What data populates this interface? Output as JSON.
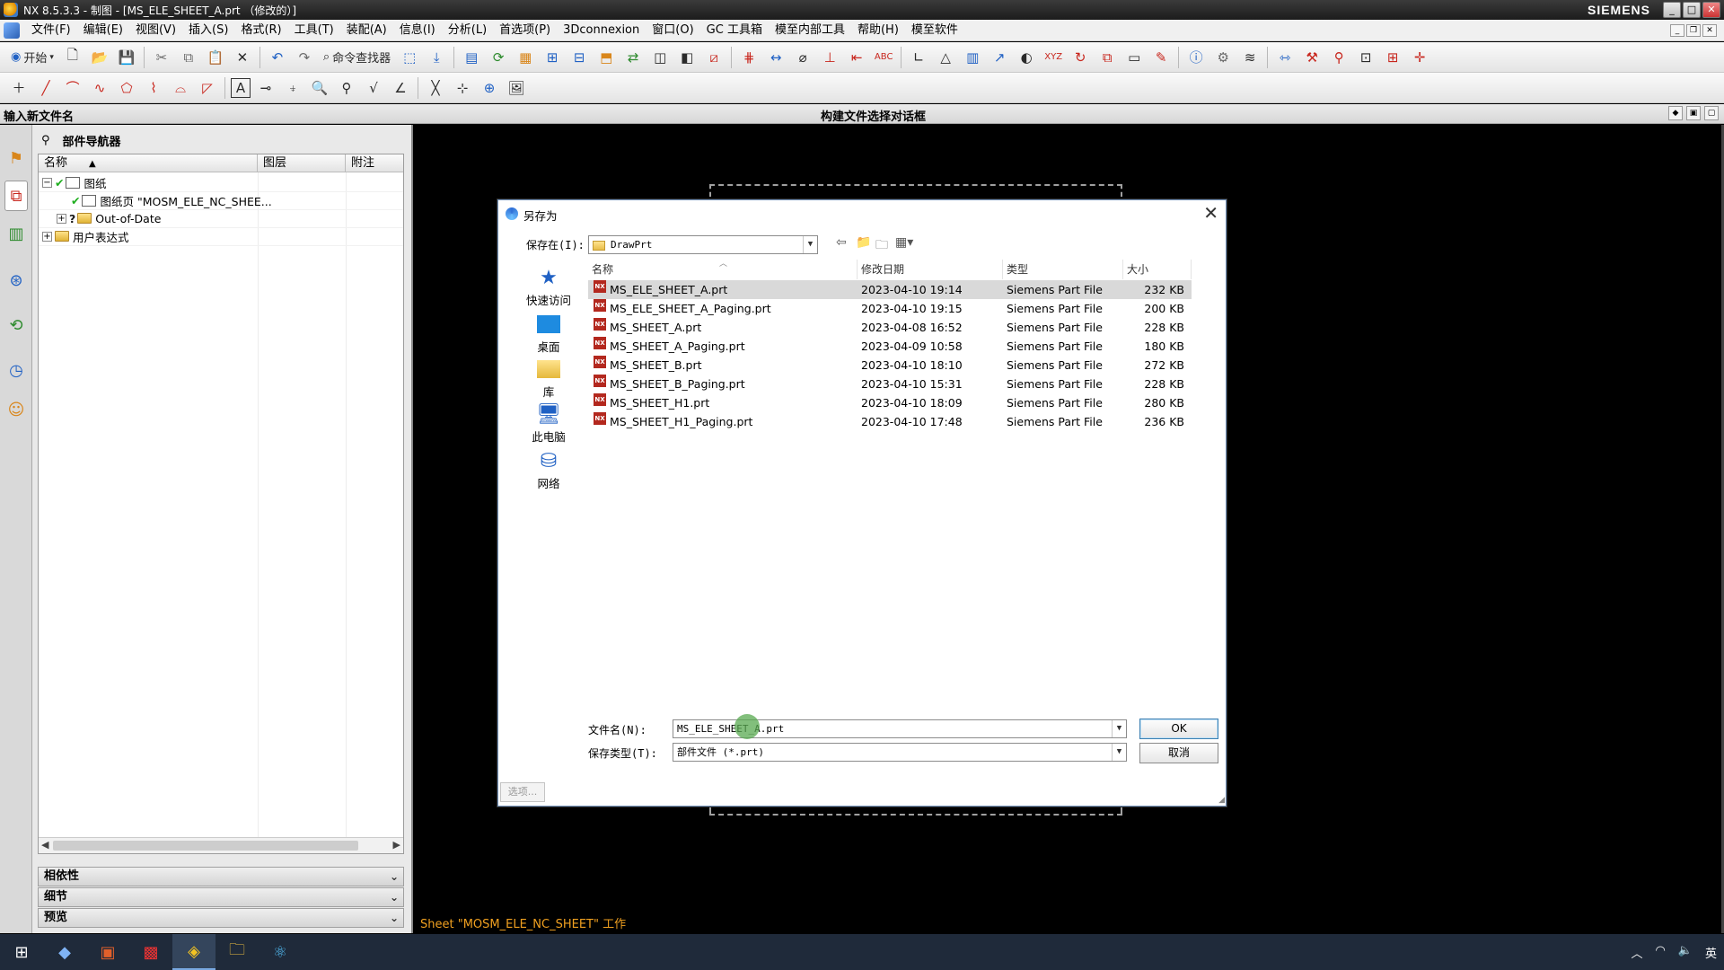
{
  "window": {
    "title": "NX 8.5.3.3 - 制图 - [MS_ELE_SHEET_A.prt （修改的）]",
    "brand": "SIEMENS",
    "controls": [
      "_",
      "□",
      "✕"
    ]
  },
  "menu": {
    "items": [
      "文件(F)",
      "编辑(E)",
      "视图(V)",
      "插入(S)",
      "格式(R)",
      "工具(T)",
      "装配(A)",
      "信息(I)",
      "分析(L)",
      "首选项(P)",
      "3Dconnexion",
      "窗口(O)",
      "GC 工具箱",
      "模至内部工具",
      "帮助(H)",
      "模至软件"
    ]
  },
  "toolbar1": {
    "start_label": "开始",
    "command_finder_label": "命令查找器"
  },
  "cue": {
    "left": "输入新文件名",
    "center": "构建文件选择对话框"
  },
  "navigator": {
    "title": "部件导航器",
    "columns": [
      "名称",
      "图层",
      "附注"
    ],
    "tree": [
      {
        "label": "图纸",
        "level": 0,
        "toggle": "−",
        "check": true
      },
      {
        "label": "图纸页 \"MOSM_ELE_NC_SHEE...",
        "level": 1,
        "toggle": "",
        "check": true
      },
      {
        "label": "Out-of-Date",
        "level": 1,
        "toggle": "+",
        "check": false,
        "question": "?"
      },
      {
        "label": "用户表达式",
        "level": 0,
        "toggle": "+",
        "check": false
      }
    ],
    "panels": [
      "相依性",
      "细节",
      "预览"
    ]
  },
  "graphics": {
    "status_message": "Sheet \"MOSM_ELE_NC_SHEET\" 工作"
  },
  "dialog": {
    "title": "另存为",
    "save_in_label": "保存在(I):",
    "save_in_value": "DrawPrt",
    "places": [
      "快速访问",
      "桌面",
      "库",
      "此电脑",
      "网络"
    ],
    "columns": [
      "名称",
      "修改日期",
      "类型",
      "大小"
    ],
    "files": [
      {
        "name": "MS_ELE_SHEET_A.prt",
        "date": "2023-04-10 19:14",
        "type": "Siemens Part File",
        "size": "232 KB",
        "selected": true
      },
      {
        "name": "MS_ELE_SHEET_A_Paging.prt",
        "date": "2023-04-10 19:15",
        "type": "Siemens Part File",
        "size": "200 KB"
      },
      {
        "name": "MS_SHEET_A.prt",
        "date": "2023-04-08 16:52",
        "type": "Siemens Part File",
        "size": "228 KB"
      },
      {
        "name": "MS_SHEET_A_Paging.prt",
        "date": "2023-04-09 10:58",
        "type": "Siemens Part File",
        "size": "180 KB"
      },
      {
        "name": "MS_SHEET_B.prt",
        "date": "2023-04-10 18:10",
        "type": "Siemens Part File",
        "size": "272 KB"
      },
      {
        "name": "MS_SHEET_B_Paging.prt",
        "date": "2023-04-10 15:31",
        "type": "Siemens Part File",
        "size": "228 KB"
      },
      {
        "name": "MS_SHEET_H1.prt",
        "date": "2023-04-10 18:09",
        "type": "Siemens Part File",
        "size": "280 KB"
      },
      {
        "name": "MS_SHEET_H1_Paging.prt",
        "date": "2023-04-10 17:48",
        "type": "Siemens Part File",
        "size": "236 KB"
      }
    ],
    "file_name_label": "文件名(N):",
    "file_name_value": "MS_ELE_SHEET_A.prt",
    "file_type_label": "保存类型(T):",
    "file_type_value": "部件文件 (*.prt)",
    "ok_label": "OK",
    "cancel_label": "取消",
    "options_label": "选项..."
  },
  "taskbar": {
    "tray_lang": "英"
  }
}
